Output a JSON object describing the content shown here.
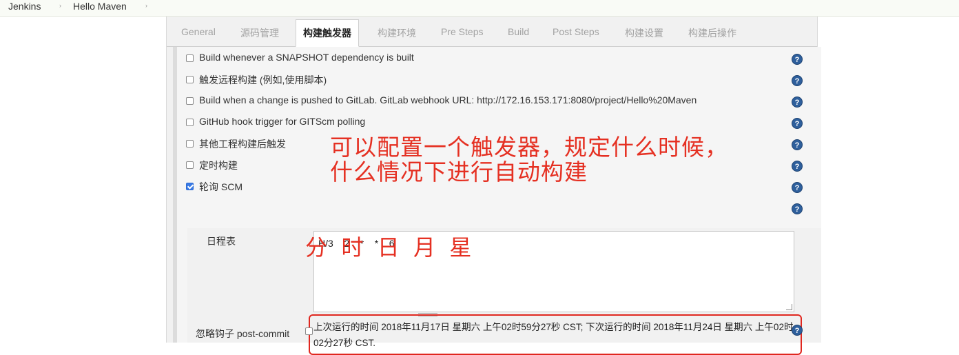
{
  "breadcrumb": {
    "items": [
      "Jenkins",
      "Hello Maven"
    ],
    "separator": "›"
  },
  "tabs": [
    "General",
    "源码管理",
    "构建触发器",
    "构建环境",
    "Pre Steps",
    "Build",
    "Post Steps",
    "构建设置",
    "构建后操作"
  ],
  "active_tab": "构建触发器",
  "triggers": [
    {
      "label": "Build whenever a SNAPSHOT dependency is built",
      "checked": false
    },
    {
      "label": "触发远程构建 (例如,使用脚本)",
      "checked": false
    },
    {
      "label": "Build when a change is pushed to GitLab. GitLab webhook URL: http://172.16.153.171:8080/project/Hello%20Maven",
      "checked": false
    },
    {
      "label": "GitHub hook trigger for GITScm polling",
      "checked": false
    },
    {
      "label": "其他工程构建后触发",
      "checked": false
    },
    {
      "label": "定时构建",
      "checked": false
    },
    {
      "label": "轮询 SCM",
      "checked": true
    }
  ],
  "schedule": {
    "label": "日程表",
    "value": "H/3    2    *    *    6",
    "info": "上次运行的时间 2018年11月17日 星期六 上午02时59分27秒 CST; 下次运行的时间 2018年11月24日 星期六 上午02时02分27秒 CST."
  },
  "ignore_post_commit": {
    "label": "忽略钩子 post-commit",
    "checked": false
  },
  "help_glyph": "?",
  "annotations": {
    "line1": "可以配置一个触发器，规定什么时候，",
    "line2": "什么情况下进行自动构建",
    "cron_fields": "分  时  日  月  星"
  },
  "colors": {
    "annotation": "#e53022",
    "help": "#2e5f9c",
    "checkbox_checked": "#3a7be6"
  }
}
